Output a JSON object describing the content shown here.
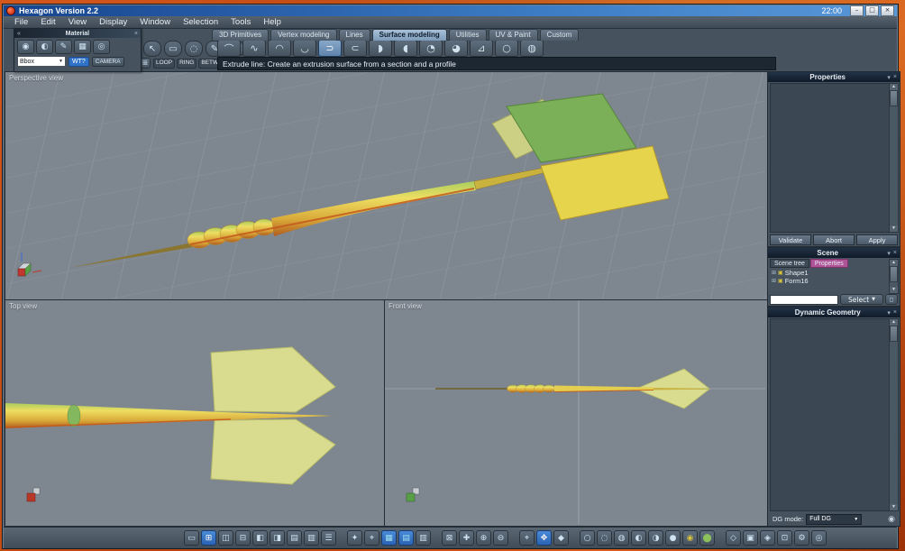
{
  "window": {
    "title": "Hexagon Version 2.2",
    "clock": "22:00",
    "controls": [
      {
        "name": "minimize-button",
        "glyph": "–"
      },
      {
        "name": "maximize-button",
        "glyph": "□"
      },
      {
        "name": "close-button",
        "glyph": "×"
      }
    ]
  },
  "menu": {
    "items": [
      {
        "name": "menu-file",
        "label": "File"
      },
      {
        "name": "menu-edit",
        "label": "Edit"
      },
      {
        "name": "menu-view",
        "label": "View"
      },
      {
        "name": "menu-display",
        "label": "Display"
      },
      {
        "name": "menu-window",
        "label": "Window"
      },
      {
        "name": "menu-selection",
        "label": "Selection"
      },
      {
        "name": "menu-tools",
        "label": "Tools"
      },
      {
        "name": "menu-help",
        "label": "Help"
      }
    ]
  },
  "tabs": {
    "items": [
      {
        "name": "tab-3d-primitives",
        "label": "3D Primitives"
      },
      {
        "name": "tab-vertex-modeling",
        "label": "Vertex modeling"
      },
      {
        "name": "tab-lines",
        "label": "Lines"
      },
      {
        "name": "tab-surface-modeling",
        "label": "Surface modeling",
        "active": true
      },
      {
        "name": "tab-utilities",
        "label": "Utilities"
      },
      {
        "name": "tab-uv-paint",
        "label": "UV & Paint"
      },
      {
        "name": "tab-custom",
        "label": "Custom"
      }
    ]
  },
  "material_panel": {
    "title": "Material",
    "nav_glyph": "«",
    "tools": [
      {
        "name": "material-ball-icon",
        "glyph": "◉"
      },
      {
        "name": "shading-ball-icon",
        "glyph": "◐"
      },
      {
        "name": "paint-tool-icon",
        "glyph": "✎"
      },
      {
        "name": "texture-grid-icon",
        "glyph": "▦"
      },
      {
        "name": "picker-icon",
        "glyph": "◎"
      }
    ],
    "dropdown_value": "Bbox",
    "wt_label": "WT?",
    "camera_label": "CAMERA"
  },
  "toolbar": {
    "selection_tools": [
      {
        "name": "select-arrow-icon",
        "glyph": "↖"
      },
      {
        "name": "rectangle-select-icon",
        "glyph": "▭"
      },
      {
        "name": "lasso-select-icon",
        "glyph": "◌"
      },
      {
        "name": "paint-select-icon",
        "glyph": "✎"
      },
      {
        "name": "loop-select-icon",
        "glyph": "◯"
      }
    ],
    "edge_grid": {
      "name": "edge-grid-icon",
      "glyph": "⊞"
    },
    "edge_buttons": [
      {
        "name": "loop-button",
        "label": "LOOP"
      },
      {
        "name": "ring-button",
        "label": "RING"
      },
      {
        "name": "betw-button",
        "label": "BETW"
      }
    ],
    "edge_dropdown_glyph": "▾",
    "surface_tools": [
      {
        "name": "ruled-surface-icon",
        "glyph": "⌒"
      },
      {
        "name": "double-sweep-icon",
        "glyph": "∿"
      },
      {
        "name": "gordon-surface-icon",
        "glyph": "◠"
      },
      {
        "name": "coons-surface-icon",
        "glyph": "◡"
      },
      {
        "name": "extrude-line-icon",
        "glyph": "⊃",
        "active": true
      },
      {
        "name": "sweep-line-icon",
        "glyph": "⊂"
      },
      {
        "name": "lathe-icon",
        "glyph": "◗"
      },
      {
        "name": "circular-sweep-icon",
        "glyph": "◖"
      },
      {
        "name": "cap-surface-icon",
        "glyph": "◔"
      },
      {
        "name": "thickness-icon",
        "glyph": "◕"
      },
      {
        "name": "offset-surface-icon",
        "glyph": "⊿"
      },
      {
        "name": "smooth-surface-icon",
        "glyph": "○"
      },
      {
        "name": "crease-icon",
        "glyph": "◍"
      }
    ],
    "hint": "Extrude line: Create an extrusion surface from a section and a profile"
  },
  "viewports": {
    "perspective_label": "Perspective view",
    "top_label": "Top view",
    "front_label": "Front view"
  },
  "properties_panel": {
    "title": "Properties",
    "buttons": [
      {
        "name": "validate-button",
        "label": "Validate"
      },
      {
        "name": "abort-button",
        "label": "Abort"
      },
      {
        "name": "apply-button",
        "label": "Apply"
      }
    ]
  },
  "scene_panel": {
    "title": "Scene",
    "tabs": [
      {
        "name": "tab-scene-tree",
        "label": "Scene tree"
      },
      {
        "name": "tab-scene-properties",
        "label": "Properties",
        "active": true
      }
    ],
    "items": [
      {
        "name": "tree-item-shape1",
        "label": "Shape1"
      },
      {
        "name": "tree-item-form16",
        "label": "Form16"
      }
    ],
    "select_label": "Select"
  },
  "dg_panel": {
    "title": "Dynamic Geometry",
    "mode_label": "DG mode:",
    "mode_value": "Full DG"
  },
  "bottom_toolbar": {
    "layout_icons": [
      {
        "name": "single-view-icon",
        "glyph": "▭"
      },
      {
        "name": "quad-view-icon",
        "glyph": "⊞",
        "active": true
      },
      {
        "name": "two-vertical-icon",
        "glyph": "◫"
      },
      {
        "name": "two-horizontal-icon",
        "glyph": "⊟"
      },
      {
        "name": "left-main-icon",
        "glyph": "◧"
      },
      {
        "name": "right-main-icon",
        "glyph": "◨"
      },
      {
        "name": "top-main-icon",
        "glyph": "▤"
      },
      {
        "name": "bottom-main-icon",
        "glyph": "▥"
      },
      {
        "name": "stacked-view-icon",
        "glyph": "☰"
      }
    ],
    "helper_icons": [
      {
        "name": "magic-tool-icon",
        "glyph": "✦"
      },
      {
        "name": "pivot-icon",
        "glyph": "⌖"
      },
      {
        "name": "grid-display-icon",
        "glyph": "▦",
        "active": true,
        "color": "#9fe0f2"
      },
      {
        "name": "plane-x-icon",
        "glyph": "▤",
        "active": true,
        "color": "#9fe0f2"
      },
      {
        "name": "plane-y-icon",
        "glyph": "▥"
      }
    ],
    "zoom_icons": [
      {
        "name": "zoom-region-icon",
        "glyph": "⊠"
      },
      {
        "name": "pan-view-icon",
        "glyph": "✚"
      },
      {
        "name": "zoom-in-icon",
        "glyph": "⊕"
      },
      {
        "name": "zoom-out-icon",
        "glyph": "⊖"
      }
    ],
    "manip_icons": [
      {
        "name": "select-mode-icon",
        "glyph": "⌖"
      },
      {
        "name": "move-mode-icon",
        "glyph": "✥",
        "active": true
      },
      {
        "name": "rotate-mode-icon",
        "glyph": "◆"
      }
    ],
    "shading_icons": [
      {
        "name": "wireframe-icon",
        "glyph": "○"
      },
      {
        "name": "hidden-line-icon",
        "glyph": "◌"
      },
      {
        "name": "flat-shading-icon",
        "glyph": "◍"
      },
      {
        "name": "smooth-shading-icon",
        "glyph": "◐"
      },
      {
        "name": "textured-shading-icon",
        "glyph": "◑"
      },
      {
        "name": "solid-shading-icon",
        "glyph": "●"
      },
      {
        "name": "material-shading-icon",
        "glyph": "◉",
        "color": "#d8c23c"
      },
      {
        "name": "rendered-shading-icon",
        "glyph": "⬤",
        "color": "#8cc05a"
      }
    ],
    "display_icons": [
      {
        "name": "transparency-icon",
        "glyph": "◇"
      },
      {
        "name": "backface-icon",
        "glyph": "▣"
      },
      {
        "name": "symmetry-icon",
        "glyph": "◈"
      },
      {
        "name": "bbox-display-icon",
        "glyph": "⊡"
      },
      {
        "name": "settings-icon",
        "glyph": "⚙"
      },
      {
        "name": "camera-view-icon",
        "glyph": "◎"
      }
    ]
  },
  "ui_glyphs": {
    "scroll_up": "▲",
    "scroll_down": "▼",
    "dropdown": "▼",
    "menu": "▾",
    "close": "×",
    "tree_expander": "⊞",
    "tree_item": "▣",
    "sphere": "◉",
    "mini_button": "◻"
  },
  "colors": {
    "dart_yellow": "#e8d24e",
    "dart_green": "#82b45e",
    "fin_pale": "#d8da8e",
    "shadow_red": "#c4571c",
    "accent_blue": "#2f72c8",
    "accent_pink": "#b05498"
  }
}
